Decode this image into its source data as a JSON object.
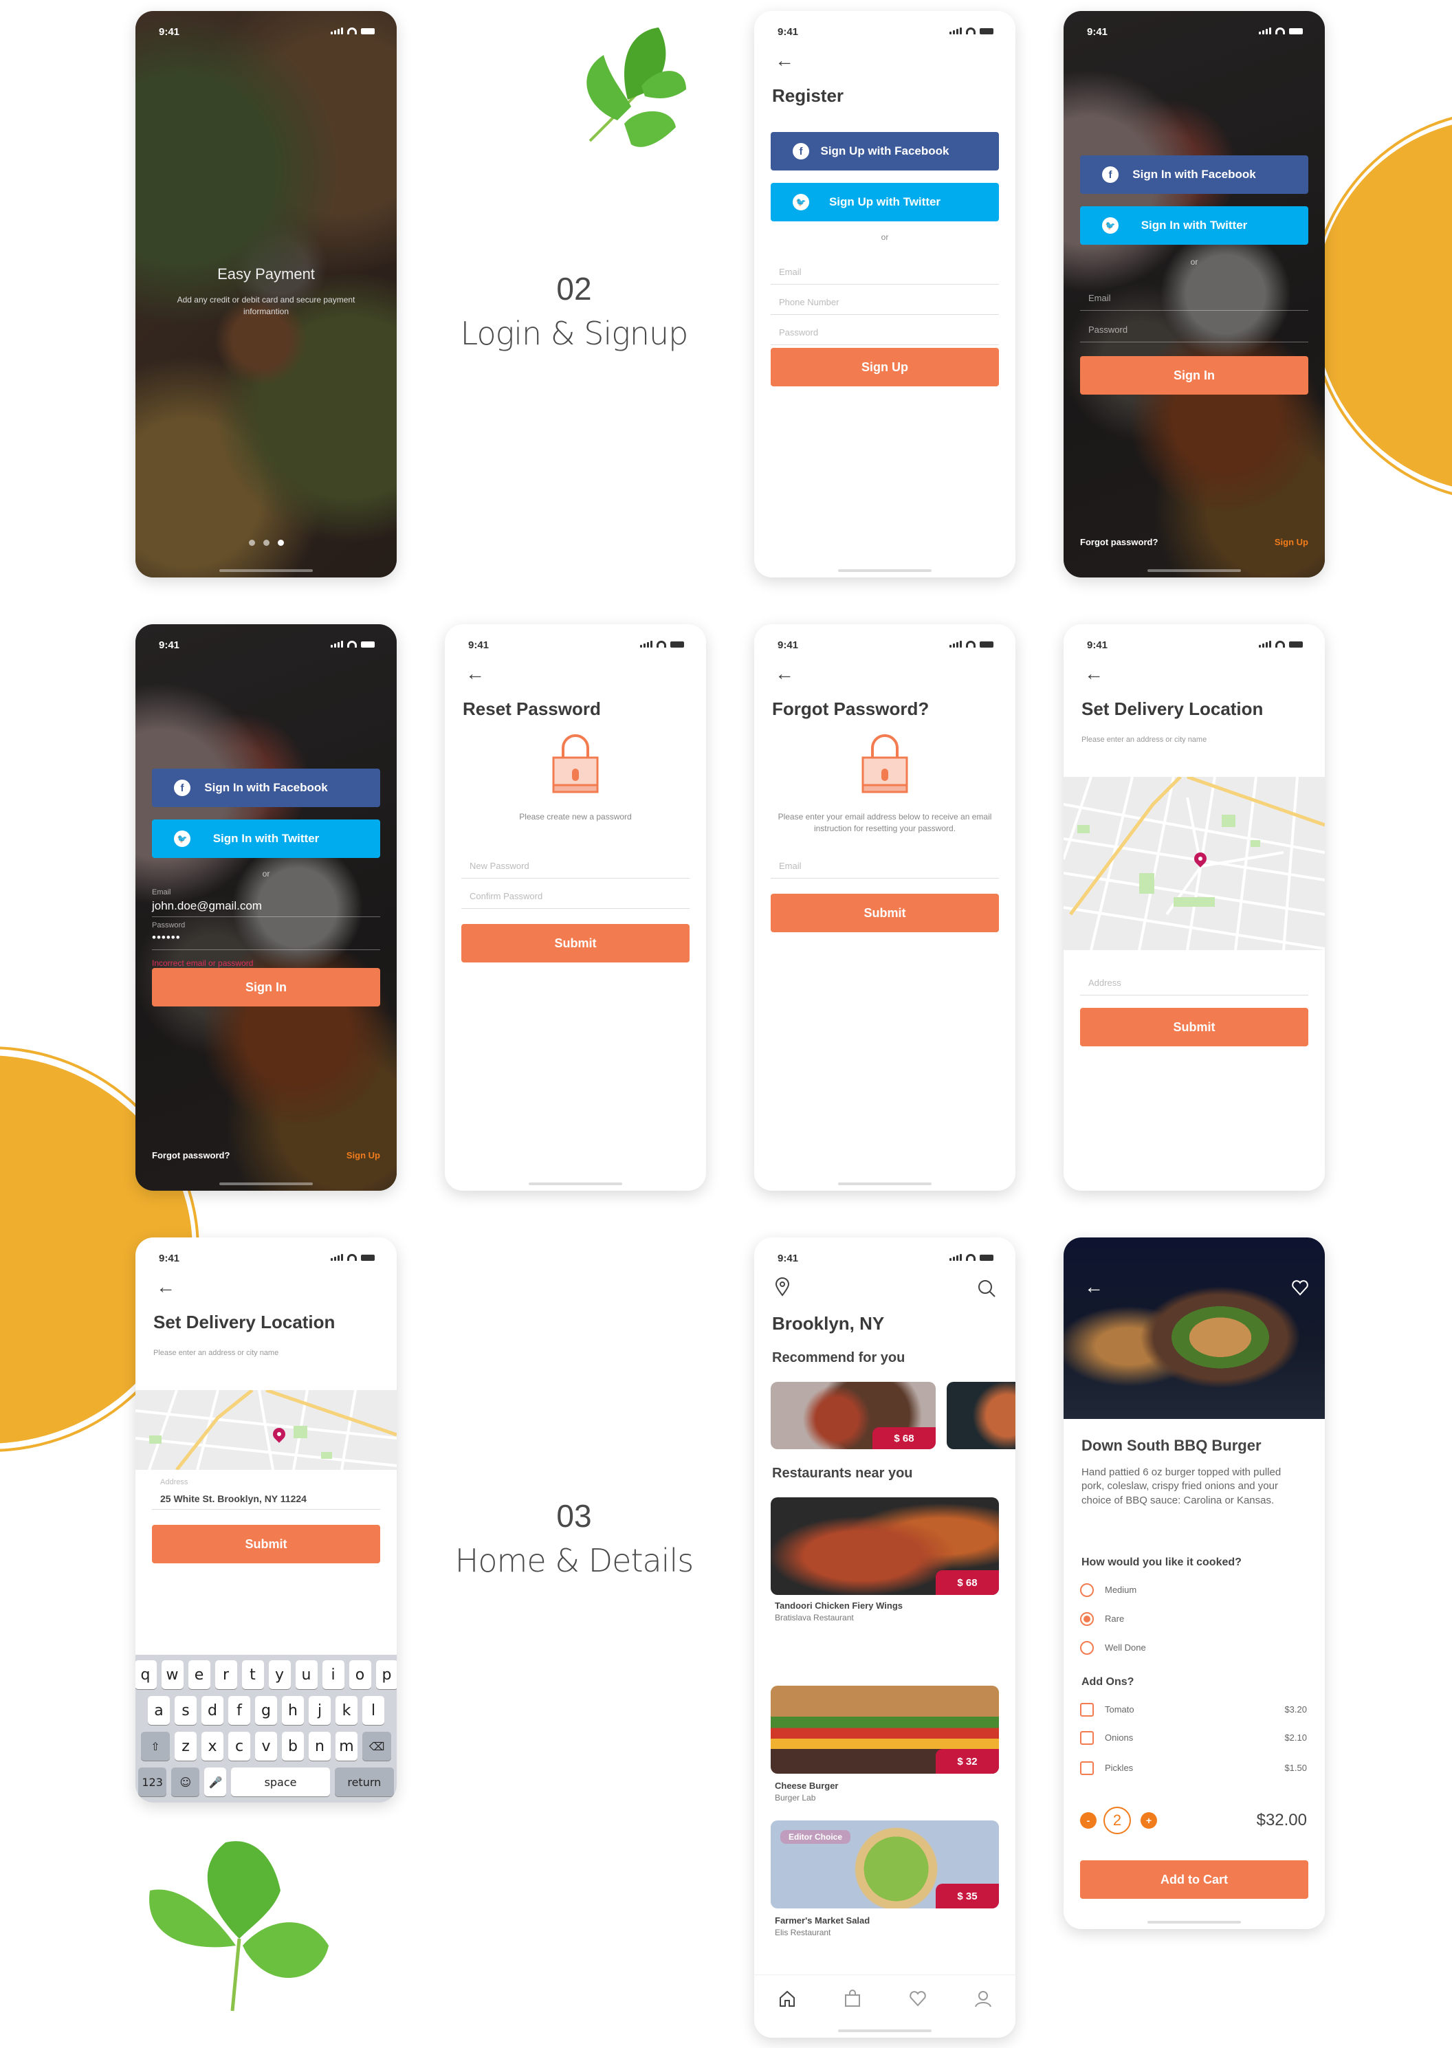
{
  "status": {
    "time": "9:41"
  },
  "sections": [
    {
      "number": "02",
      "title": "Login & Signup"
    },
    {
      "number": "03",
      "title": "Home & Details"
    }
  ],
  "onboarding": {
    "title": "Easy Payment",
    "description": "Add any credit or debit card and secure payment informantion",
    "page_count": 3,
    "active_page": 3
  },
  "register": {
    "title": "Register",
    "facebook_label": "Sign Up with Facebook",
    "twitter_label": "Sign Up with Twitter",
    "or": "or",
    "email_placeholder": "Email",
    "phone_placeholder": "Phone Number",
    "password_placeholder": "Password",
    "submit_label": "Sign Up"
  },
  "signin": {
    "facebook_label": "Sign In with Facebook",
    "twitter_label": "Sign In with Twitter",
    "or": "or",
    "email_placeholder": "Email",
    "password_placeholder": "Password",
    "submit_label": "Sign In",
    "forgot_label": "Forgot password?",
    "signup_label": "Sign Up"
  },
  "signin_error": {
    "facebook_label": "Sign In with Facebook",
    "twitter_label": "Sign In with Twitter",
    "or": "or",
    "email_label": "Email",
    "email_value": "john.doe@gmail.com",
    "password_label": "Password",
    "password_value": "••••••",
    "error_text": "Incorrect email or password",
    "submit_label": "Sign In",
    "forgot_label": "Forgot password?",
    "signup_label": "Sign Up"
  },
  "reset_password": {
    "title": "Reset Password",
    "info": "Please create new a password",
    "new_placeholder": "New Password",
    "confirm_placeholder": "Confirm Password",
    "submit_label": "Submit"
  },
  "forgot_password": {
    "title": "Forgot Password?",
    "info": "Please enter your email address below to receive an email instruction for resetting your password.",
    "email_placeholder": "Email",
    "submit_label": "Submit"
  },
  "delivery": {
    "title": "Set Delivery Location",
    "subtitle": "Please enter an address or city name",
    "address_placeholder": "Address",
    "submit_label": "Submit"
  },
  "delivery_filled": {
    "title": "Set Delivery Location",
    "subtitle": "Please enter an address or city name",
    "address_label": "Address",
    "address_value": "25 White St. Brooklyn, NY 11224",
    "submit_label": "Submit",
    "keyboard": {
      "row1": [
        "q",
        "w",
        "e",
        "r",
        "t",
        "y",
        "u",
        "i",
        "o",
        "p"
      ],
      "row2": [
        "a",
        "s",
        "d",
        "f",
        "g",
        "h",
        "j",
        "k",
        "l"
      ],
      "row3": [
        "z",
        "x",
        "c",
        "v",
        "b",
        "n",
        "m"
      ],
      "numbers": "123",
      "space": "space",
      "return": "return"
    }
  },
  "home": {
    "location": "Brooklyn, NY",
    "recommend_title": "Recommend for you",
    "recommend": [
      {
        "price": "$ 68"
      }
    ],
    "nearby_title": "Restaurants near you",
    "restaurants": [
      {
        "name": "Tandoori Chicken Fiery Wings",
        "restaurant": "Bratislava Restaurant",
        "price": "$ 68"
      },
      {
        "name": "Cheese Burger",
        "restaurant": "Burger Lab",
        "price": "$ 32"
      },
      {
        "name": "Farmer's Market Salad",
        "restaurant": "Elis Restaurant",
        "price": "$ 35",
        "badge": "Editor Choice"
      }
    ],
    "tabs": [
      "home",
      "bag",
      "favorites",
      "profile"
    ]
  },
  "details": {
    "title": "Down South BBQ Burger",
    "description": "Hand pattied 6 oz burger topped with pulled pork, coleslaw, crispy fried onions and your choice of BBQ sauce: Carolina or Kansas.",
    "cook_question": "How would you like it cooked?",
    "cook_options": [
      {
        "label": "Medium",
        "selected": false
      },
      {
        "label": "Rare",
        "selected": true
      },
      {
        "label": "Well Done",
        "selected": false
      }
    ],
    "addons_title": "Add Ons?",
    "addons": [
      {
        "label": "Tomato",
        "price": "$3.20",
        "checked": false
      },
      {
        "label": "Onions",
        "price": "$2.10",
        "checked": false
      },
      {
        "label": "Pickles",
        "price": "$1.50",
        "checked": false
      }
    ],
    "quantity": "2",
    "minus": "-",
    "plus": "+",
    "total": "$32.00",
    "add_to_cart": "Add to Cart"
  },
  "colors": {
    "accent": "#f27c50",
    "facebook": "#3c5a99",
    "twitter": "#00aced",
    "price_tag": "#c8173f",
    "deco": "#efae2e"
  }
}
